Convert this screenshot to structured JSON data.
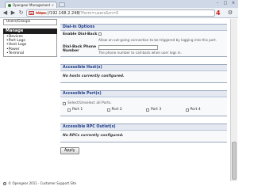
{
  "browser": {
    "tab_title": "Opengear Management Cons...",
    "tab_close": "×",
    "window_controls": [
      "–",
      "□",
      "×"
    ],
    "nav": {
      "back": "◀",
      "forward": "▶",
      "reload": "↻"
    },
    "url_scheme": "https",
    "url_host": "://192.168.2.248/",
    "url_path": "?form=users&m=0",
    "badge": "4"
  },
  "sidebar": {
    "top_item": "Users/Groups",
    "manage_header": "Manage",
    "items": [
      "Devices",
      "Port Logs",
      "Host Logs",
      "Power",
      "Terminal"
    ]
  },
  "dialin": {
    "title": "Dial-in Options",
    "callback_label": "Enable Dial-Back",
    "callback_hint": "Allow an out-going connection to be triggered by logging into this port.",
    "phone_label": "Dial-Back Phone Number",
    "phone_value": "",
    "phone_hint": "The phone number to call-back when user logs in."
  },
  "hosts": {
    "title": "Accessible Host(s)",
    "empty": "No hosts currently configured."
  },
  "ports": {
    "title": "Accessible Port(s)",
    "select_all": "Select/Unselect all Ports.",
    "items": [
      "Port 1",
      "Port 2",
      "Port 3",
      "Port 4"
    ]
  },
  "rpc": {
    "title": "Accessible RPC Outlet(s)",
    "empty": "No RPCs currently configured."
  },
  "actions": {
    "apply": "Apply"
  },
  "footer": {
    "text": "© Opengear 2011 · Customer Support Site"
  }
}
